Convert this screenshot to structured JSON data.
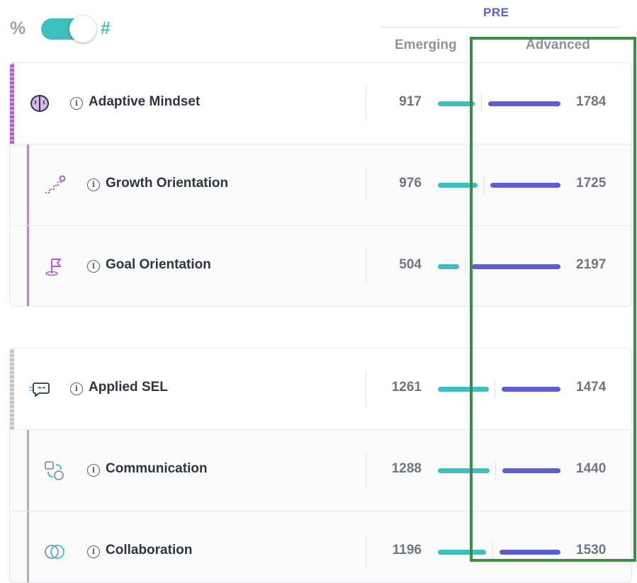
{
  "toggle": {
    "percent_label": "%",
    "count_label": "#",
    "state": "on"
  },
  "header": {
    "phase": "PRE",
    "col_left": "Emerging",
    "col_right": "Advanced"
  },
  "colors": {
    "teal": "#3dbfc2",
    "indigo": "#5b5fcf",
    "highlight": "#3a8f48",
    "mindset": "#b35fce",
    "sel": "#b9bec6"
  },
  "groups": [
    {
      "parent": {
        "label": "Adaptive Mindset",
        "icon": "brain-icon",
        "emerging": "917",
        "advanced": "1784"
      },
      "children": [
        {
          "label": "Growth Orientation",
          "icon": "stairs-icon",
          "emerging": "976",
          "advanced": "1725"
        },
        {
          "label": "Goal Orientation",
          "icon": "flag-icon",
          "emerging": "504",
          "advanced": "2197"
        }
      ]
    },
    {
      "parent": {
        "label": "Applied SEL",
        "icon": "chat-bubble-icon",
        "emerging": "1261",
        "advanced": "1474"
      },
      "children": [
        {
          "label": "Communication",
          "icon": "communication-icon",
          "emerging": "1288",
          "advanced": "1440"
        },
        {
          "label": "Collaboration",
          "icon": "overlapping-circles-icon",
          "emerging": "1196",
          "advanced": "1530"
        }
      ]
    }
  ]
}
